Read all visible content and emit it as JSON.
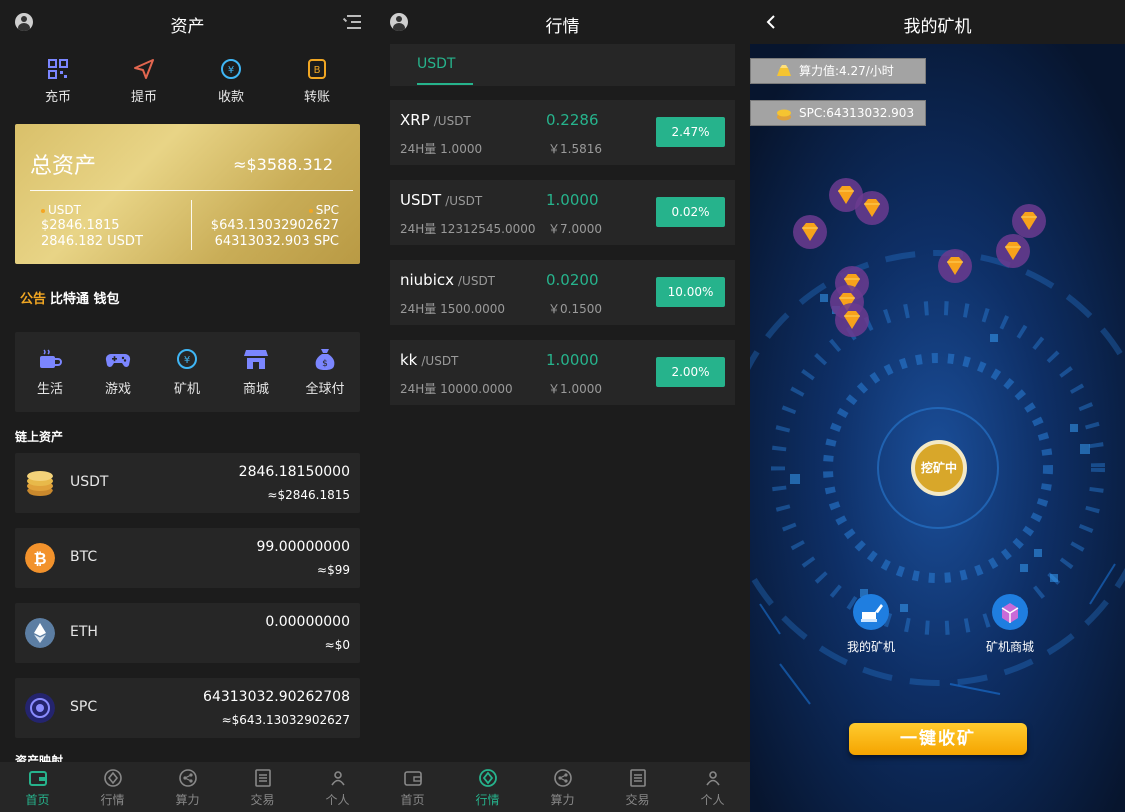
{
  "assets_page": {
    "title": "资产",
    "actions": [
      "充币",
      "提币",
      "收款",
      "转账"
    ],
    "total": {
      "label": "总资产",
      "value": "≈$3588.312",
      "left": {
        "coin": "USDT",
        "usd": "$2846.1815",
        "amount": "2846.182 USDT"
      },
      "right": {
        "coin": "SPC",
        "usd": "$643.13032902627",
        "amount": "64313032.903 SPC"
      }
    },
    "notice": {
      "tag": "公告",
      "text": "比特通 钱包"
    },
    "apps": [
      "生活",
      "游戏",
      "矿机",
      "商城",
      "全球付"
    ],
    "section_title": "链上资产",
    "assets": [
      {
        "symbol": "USDT",
        "amount": "2846.18150000",
        "fiat": "≈$2846.1815",
        "color": "#e8b94a"
      },
      {
        "symbol": "BTC",
        "amount": "99.00000000",
        "fiat": "≈$99",
        "color": "#f2922c"
      },
      {
        "symbol": "ETH",
        "amount": "0.00000000",
        "fiat": "≈$0",
        "color": "#5c7ea3"
      },
      {
        "symbol": "SPC",
        "amount": "64313032.90262708",
        "fiat": "≈$643.13032902627",
        "color": "#24246e"
      }
    ],
    "cut_section": "资产映射"
  },
  "market_page": {
    "title": "行情",
    "tab": "USDT",
    "rows": [
      {
        "base": "XRP",
        "quote": "/USDT",
        "price": "0.2286",
        "volume": "24H量 1.0000",
        "cny": "￥1.5816",
        "change": "2.47%"
      },
      {
        "base": "USDT",
        "quote": "/USDT",
        "price": "1.0000",
        "volume": "24H量 12312545.0000",
        "cny": "￥7.0000",
        "change": "0.02%"
      },
      {
        "base": "niubicx",
        "quote": "/USDT",
        "price": "0.0200",
        "volume": "24H量 1500.0000",
        "cny": "￥0.1500",
        "change": "10.00%"
      },
      {
        "base": "kk",
        "quote": "/USDT",
        "price": "1.0000",
        "volume": "24H量 10000.0000",
        "cny": "￥1.0000",
        "change": "2.00%"
      }
    ]
  },
  "mining_page": {
    "title": "我的矿机",
    "hashrate": "算力值:4.27/小时",
    "spc": "SPC:64313032.903",
    "center": "挖矿中",
    "my_miner": "我的矿机",
    "miner_shop": "矿机商城",
    "collect": "一键收矿"
  },
  "tabbar": [
    "首页",
    "行情",
    "算力",
    "交易",
    "个人"
  ],
  "colors": {
    "accent": "#26b38c",
    "gold": "#d9c06a",
    "panel": "#262626",
    "bg": "#1c1c1c"
  }
}
